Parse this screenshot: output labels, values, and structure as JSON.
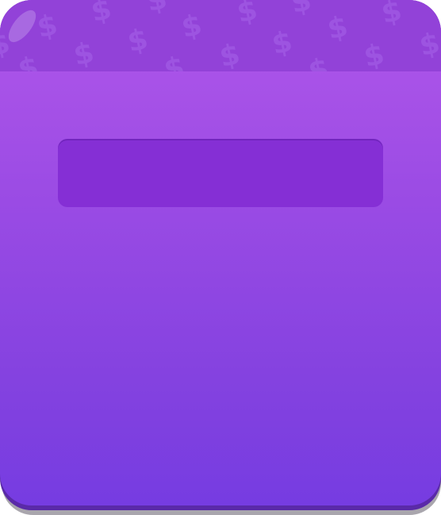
{
  "panel": {
    "label_text": "",
    "header_pattern_glyph": "$",
    "header_pattern_icon": "dollar-sign-icon"
  },
  "colors": {
    "header": "#9242d8",
    "body_top": "#b157ea",
    "body_bottom": "#763ce1",
    "label_slot": "#852fd5",
    "rim": "#5a2aa8",
    "pattern_glyph": "#a45fe6"
  }
}
